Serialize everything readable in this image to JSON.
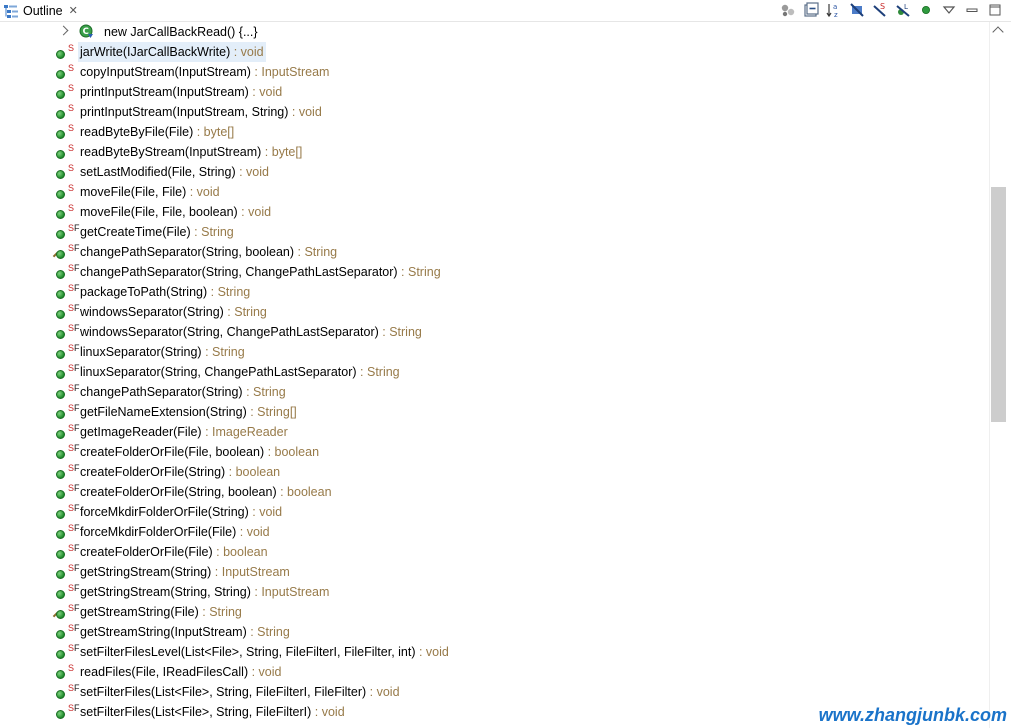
{
  "tab": {
    "title": "Outline",
    "close": "✕"
  },
  "toolbar": [
    {
      "name": "hide-non-public-icon"
    },
    {
      "name": "collapse-all-icon"
    },
    {
      "name": "sort-icon"
    },
    {
      "name": "hide-fields-icon"
    },
    {
      "name": "hide-static-icon"
    },
    {
      "name": "hide-non-public-members-icon"
    },
    {
      "name": "focus-active-icon"
    },
    {
      "name": "view-menu-icon"
    },
    {
      "name": "minimize-icon"
    },
    {
      "name": "maximize-icon"
    }
  ],
  "anon": {
    "label": "new JarCallBackRead() {...}"
  },
  "items": [
    {
      "name": "jarWrite(IJarCallBackWrite)",
      "type": " : void",
      "mod": "S",
      "selected": true
    },
    {
      "name": "copyInputStream(InputStream)",
      "type": " : InputStream",
      "mod": "S"
    },
    {
      "name": "printInputStream(InputStream)",
      "type": " : void",
      "mod": "S"
    },
    {
      "name": "printInputStream(InputStream, String)",
      "type": " : void",
      "mod": "S"
    },
    {
      "name": "readByteByFile(File)",
      "type": " : byte[]",
      "mod": "S"
    },
    {
      "name": "readByteByStream(InputStream)",
      "type": " : byte[]",
      "mod": "S"
    },
    {
      "name": "setLastModified(File, String)",
      "type": " : void",
      "mod": "S"
    },
    {
      "name": "moveFile(File, File)",
      "type": " : void",
      "mod": "S"
    },
    {
      "name": "moveFile(File, File, boolean)",
      "type": " : void",
      "mod": "S"
    },
    {
      "name": "getCreateTime(File)",
      "type": " : String",
      "mod": "SF"
    },
    {
      "name": "changePathSeparator(String, boolean)",
      "type": " : String",
      "mod": "SF",
      "overload": true
    },
    {
      "name": "changePathSeparator(String, ChangePathLastSeparator)",
      "type": " : String",
      "mod": "SF"
    },
    {
      "name": "packageToPath(String)",
      "type": " : String",
      "mod": "SF"
    },
    {
      "name": "windowsSeparator(String)",
      "type": " : String",
      "mod": "SF"
    },
    {
      "name": "windowsSeparator(String, ChangePathLastSeparator)",
      "type": " : String",
      "mod": "SF"
    },
    {
      "name": "linuxSeparator(String)",
      "type": " : String",
      "mod": "SF"
    },
    {
      "name": "linuxSeparator(String, ChangePathLastSeparator)",
      "type": " : String",
      "mod": "SF"
    },
    {
      "name": "changePathSeparator(String)",
      "type": " : String",
      "mod": "SF"
    },
    {
      "name": "getFileNameExtension(String)",
      "type": " : String[]",
      "mod": "SF"
    },
    {
      "name": "getImageReader(File)",
      "type": " : ImageReader",
      "mod": "SF"
    },
    {
      "name": "createFolderOrFile(File, boolean)",
      "type": " : boolean",
      "mod": "SF"
    },
    {
      "name": "createFolderOrFile(String)",
      "type": " : boolean",
      "mod": "SF"
    },
    {
      "name": "createFolderOrFile(String, boolean)",
      "type": " : boolean",
      "mod": "SF"
    },
    {
      "name": "forceMkdirFolderOrFile(String)",
      "type": " : void",
      "mod": "SF"
    },
    {
      "name": "forceMkdirFolderOrFile(File)",
      "type": " : void",
      "mod": "SF"
    },
    {
      "name": "createFolderOrFile(File)",
      "type": " : boolean",
      "mod": "SF"
    },
    {
      "name": "getStringStream(String)",
      "type": " : InputStream",
      "mod": "SF"
    },
    {
      "name": "getStringStream(String, String)",
      "type": " : InputStream",
      "mod": "SF"
    },
    {
      "name": "getStreamString(File)",
      "type": " : String",
      "mod": "SF",
      "overload": true
    },
    {
      "name": "getStreamString(InputStream)",
      "type": " : String",
      "mod": "SF"
    },
    {
      "name": "setFilterFilesLevel(List<File>, String, FileFilterI, FileFilter, int)",
      "type": " : void",
      "mod": "SF"
    },
    {
      "name": "readFiles(File, IReadFilesCall)",
      "type": " : void",
      "mod": "S"
    },
    {
      "name": "setFilterFiles(List<File>, String, FileFilterI, FileFilter)",
      "type": " : void",
      "mod": "SF"
    },
    {
      "name": "setFilterFiles(List<File>, String, FileFilterI)",
      "type": " : void",
      "mod": "SF"
    }
  ],
  "watermark": "www.zhangjunbk.com",
  "colors": {
    "returnType": "#977a49",
    "selected": "#e3eef9",
    "staticMarker": "#c82828"
  }
}
